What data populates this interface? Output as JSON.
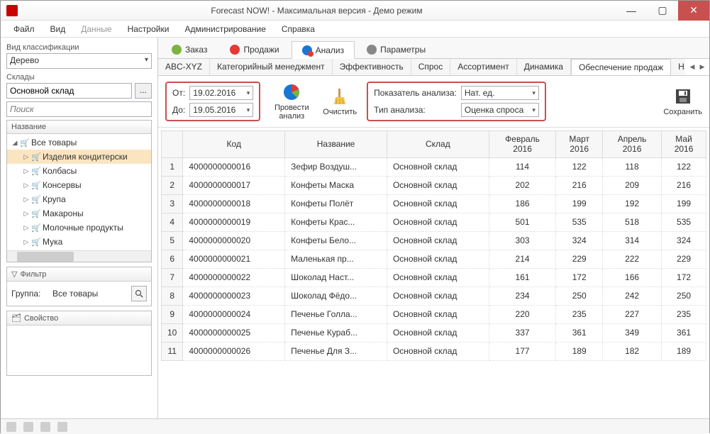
{
  "window": {
    "title": "Forecast NOW! - Максимальная версия - Демо режим"
  },
  "menubar": [
    "Файл",
    "Вид",
    "Данные",
    "Настройки",
    "Администрирование",
    "Справка"
  ],
  "sidebar": {
    "class_label": "Вид классификации",
    "class_value": "Дерево",
    "warehouses_label": "Склады",
    "warehouse_value": "Основной склад",
    "search_placeholder": "Поиск",
    "tree_header": "Название",
    "tree_root": "Все товары",
    "tree_items": [
      "Изделия кондитерски",
      "Колбасы",
      "Консервы",
      "Крупа",
      "Макароны",
      "Молочные продукты",
      "Мука"
    ],
    "filter_header": "Фильтр",
    "filter_group_label": "Группа:",
    "filter_group_value": "Все товары",
    "prop_header": "Свойство"
  },
  "maintabs": [
    {
      "label": "Заказ"
    },
    {
      "label": "Продажи"
    },
    {
      "label": "Анализ"
    },
    {
      "label": "Параметры"
    }
  ],
  "subtabs": [
    "ABC-XYZ",
    "Категорийный менеджмент",
    "Эффективность",
    "Спрос",
    "Ассортимент",
    "Динамика",
    "Обеспечение продаж",
    "Н.О.с"
  ],
  "toolbar": {
    "from_label": "От:",
    "to_label": "До:",
    "from_value": "19.02.2016",
    "to_value": "19.05.2016",
    "run_label": "Провести анализ",
    "clear_label": "Очистить",
    "indicator_label": "Показатель анализа:",
    "indicator_value": "Нат. ед.",
    "type_label": "Тип анализа:",
    "type_value": "Оценка спроса",
    "save_label": "Сохранить"
  },
  "grid": {
    "headers": [
      "Код",
      "Название",
      "Склад",
      "Февраль 2016",
      "Март 2016",
      "Апрель 2016",
      "Май 2016"
    ],
    "rows": [
      {
        "n": 1,
        "code": "4000000000016",
        "name": "Зефир Воздуш...",
        "wh": "Основной склад",
        "v": [
          114,
          122,
          118,
          122
        ]
      },
      {
        "n": 2,
        "code": "4000000000017",
        "name": "Конфеты Маска",
        "wh": "Основной склад",
        "v": [
          202,
          216,
          209,
          216
        ]
      },
      {
        "n": 3,
        "code": "4000000000018",
        "name": "Конфеты Полёт",
        "wh": "Основной склад",
        "v": [
          186,
          199,
          192,
          199
        ]
      },
      {
        "n": 4,
        "code": "4000000000019",
        "name": "Конфеты Крас...",
        "wh": "Основной склад",
        "v": [
          501,
          535,
          518,
          535
        ]
      },
      {
        "n": 5,
        "code": "4000000000020",
        "name": "Конфеты Бело...",
        "wh": "Основной склад",
        "v": [
          303,
          324,
          314,
          324
        ]
      },
      {
        "n": 6,
        "code": "4000000000021",
        "name": "Маленькая пр...",
        "wh": "Основной склад",
        "v": [
          214,
          229,
          222,
          229
        ]
      },
      {
        "n": 7,
        "code": "4000000000022",
        "name": "Шоколад Наст...",
        "wh": "Основной склад",
        "v": [
          161,
          172,
          166,
          172
        ]
      },
      {
        "n": 8,
        "code": "4000000000023",
        "name": "Шоколад Фёдо...",
        "wh": "Основной склад",
        "v": [
          234,
          250,
          242,
          250
        ]
      },
      {
        "n": 9,
        "code": "4000000000024",
        "name": "Печенье Голла...",
        "wh": "Основной склад",
        "v": [
          220,
          235,
          227,
          235
        ]
      },
      {
        "n": 10,
        "code": "4000000000025",
        "name": "Печенье Кураб...",
        "wh": "Основной склад",
        "v": [
          337,
          361,
          349,
          361
        ]
      },
      {
        "n": 11,
        "code": "4000000000026",
        "name": "Печенье Для З...",
        "wh": "Основной склад",
        "v": [
          177,
          189,
          182,
          189
        ]
      }
    ]
  }
}
